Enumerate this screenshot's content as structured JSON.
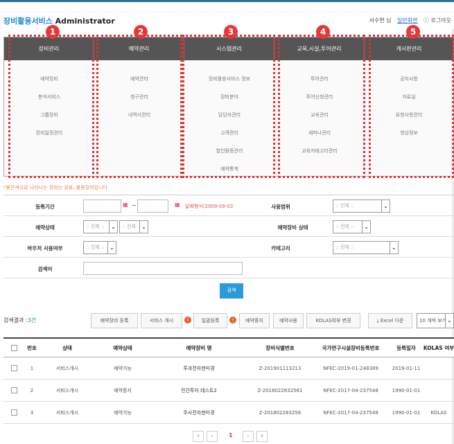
{
  "header": {
    "brand": "장비활용서비스",
    "title_suffix": " Administrator",
    "user": "서수현 님",
    "user_page_link": "일반화면",
    "logout": "ⓘ 로그아웃"
  },
  "menu": [
    {
      "num": "1",
      "title": "장비관리",
      "items": [
        "예약장비",
        "분석서비스",
        "그룹장비",
        "장비일정관리"
      ]
    },
    {
      "num": "2",
      "title": "예약관리",
      "items": [
        "예약관리",
        "청구관리",
        "내역서관리"
      ]
    },
    {
      "num": "3",
      "title": "시스템관리",
      "items": [
        "장비활용서비스 정보",
        "장비분야",
        "담당자관리",
        "고객관리",
        "할인활증관리",
        "예약통계"
      ]
    },
    {
      "num": "4",
      "title": "교육,시설,투어관리",
      "items": [
        "투어관리",
        "투어신청관리",
        "교육관리",
        "세미나관리",
        "교육카테고리관리"
      ]
    },
    {
      "num": "5",
      "title": "게시판관리",
      "items": [
        "공지사항",
        "자료실",
        "요청사항관리",
        "영상정보"
      ]
    }
  ],
  "note": "*붉은색으로 나타나는 장비는 유휴, 불용장비입니다.",
  "form": {
    "period_label": "등록기간",
    "tilde": "~",
    "date_hint": "날짜형식(2009-09-03",
    "scope_label": "사용범위",
    "scope_value": ":: 전체 ::",
    "status_label": "예약상태",
    "status_value1": ":: 전체 ::",
    "status_value2": ":: 전체 ::",
    "equip_status_label": "예약장비 상태",
    "equip_status_value": ":: 전체 ::",
    "voucher_label": "바우처 사용여부",
    "voucher_value": ":: 전체 ::",
    "category_label": "카테고리",
    "category_value": ":: 전체 ::",
    "keyword_label": "검색어",
    "keyword_value": "",
    "search_button": "검색"
  },
  "results": {
    "label": "검색결과 :",
    "count": "3건"
  },
  "toolbar": {
    "register": "예약장비 등록",
    "service_start": "서비스 개시",
    "bulk_register": "일괄등록",
    "stop": "예약중지",
    "use": "예약사용",
    "kolas_change": "KOLAS여부 변경",
    "excel": "Excel 다운",
    "page_size": "10 개씩 보기"
  },
  "table": {
    "headers": [
      "번호",
      "상태",
      "예약상태",
      "예약장비 명",
      "장비식별번호",
      "국가연구시설장비등록번호",
      "등록일자",
      "KOLAS 여부"
    ],
    "rows": [
      {
        "no": "1",
        "status": "서비스개시",
        "reserve": "예약가능",
        "name": "투과전자현미경",
        "id": "Z-201901113213",
        "reg": "NFEC-2019-01-248389",
        "date": "2019-01-11",
        "kolas": ""
      },
      {
        "no": "2",
        "status": "서비스개시",
        "reserve": "예약중지",
        "name": "민간투자 테스트2",
        "id": "Z-2018022832561",
        "reg": "NFEC-2017-04-237548",
        "date": "1990-01-01",
        "kolas": ""
      },
      {
        "no": "3",
        "status": "서비스개시",
        "reserve": "예약가능",
        "name": "주사전자현미경",
        "id": "Z-201802283256",
        "reg": "NFEC-2017-04-237548",
        "date": "1990-01-01",
        "kolas": "KOLAS"
      }
    ]
  },
  "pagination": {
    "first": "«",
    "prev": "‹",
    "current": "1",
    "next": "›",
    "last": "»"
  }
}
